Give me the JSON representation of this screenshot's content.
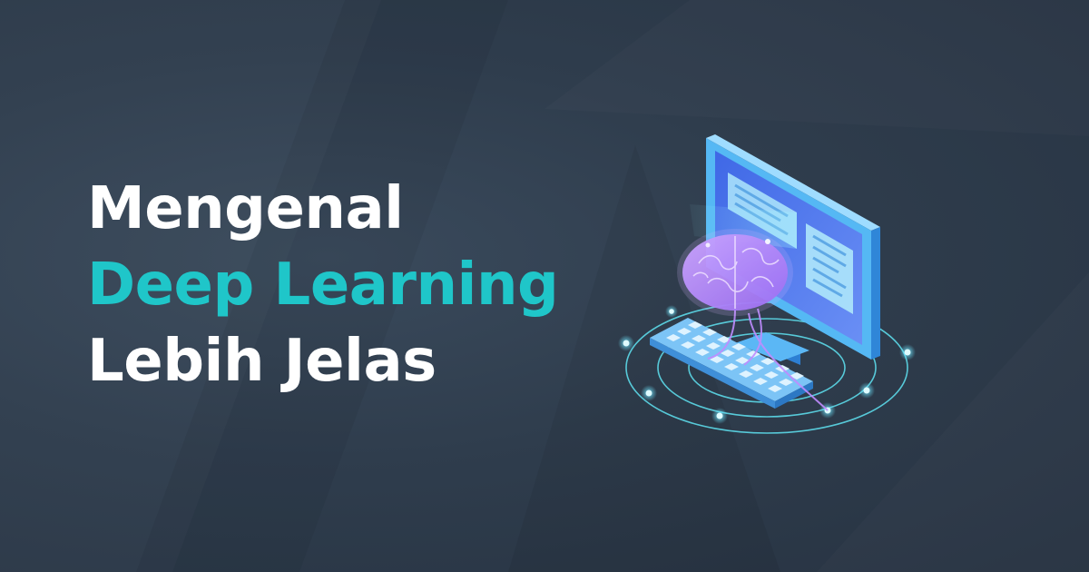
{
  "headline": {
    "line_1": "Mengenal",
    "line_2": "Deep Learning",
    "line_3": "Lebih Jelas"
  },
  "colors": {
    "background": "#2f3d4d",
    "headline_white": "#ffffff",
    "headline_accent": "#1fc6c9",
    "glow_cyan": "#6fe6ff",
    "brain_purple": "#b58cf5",
    "monitor_blue": "#4aa7ee"
  },
  "illustration": {
    "icons": [
      "computer-monitor-icon",
      "keyboard-icon",
      "brain-icon",
      "orbit-rings-icon"
    ]
  }
}
